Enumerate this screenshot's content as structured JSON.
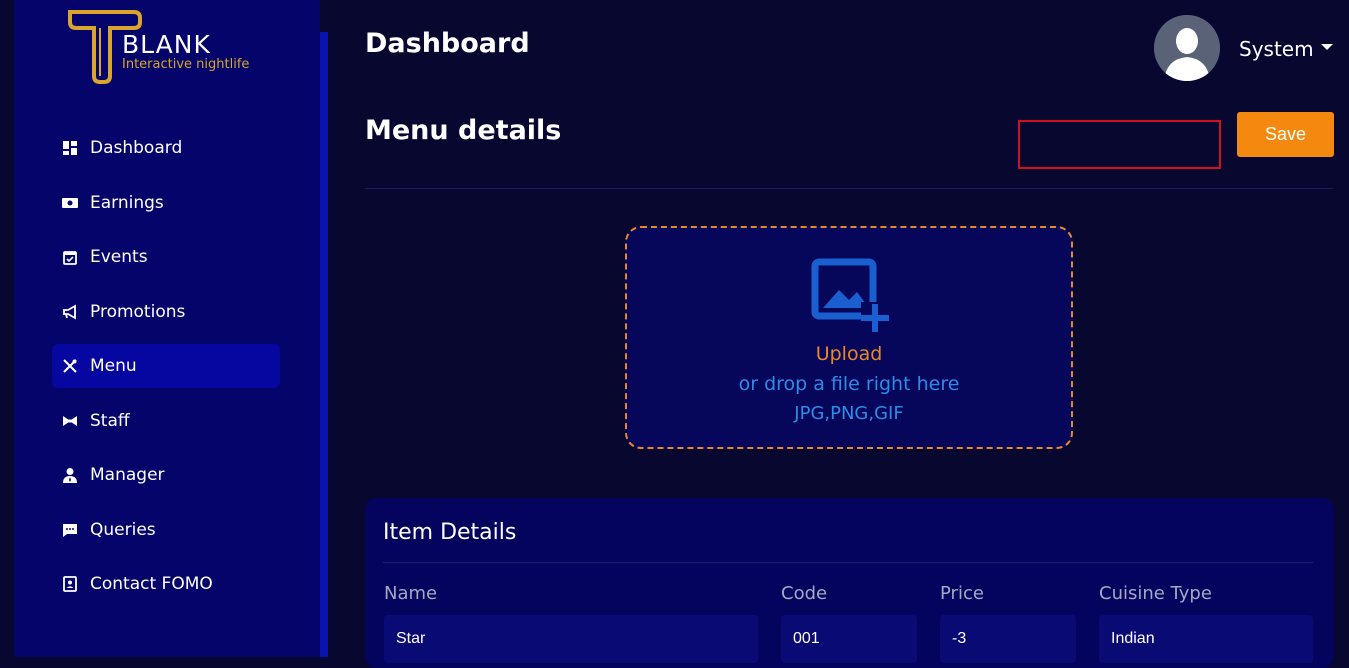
{
  "brand": {
    "title": "BLANK",
    "subtitle": "Interactive nightlife"
  },
  "sidebar": {
    "items": [
      {
        "label": "Dashboard",
        "icon": "dashboard-icon",
        "active": false
      },
      {
        "label": "Earnings",
        "icon": "money-icon",
        "active": false
      },
      {
        "label": "Events",
        "icon": "calendar-icon",
        "active": false
      },
      {
        "label": "Promotions",
        "icon": "megaphone-icon",
        "active": false
      },
      {
        "label": "Menu",
        "icon": "utensils-icon",
        "active": true
      },
      {
        "label": "Staff",
        "icon": "bowtie-icon",
        "active": false
      },
      {
        "label": "Manager",
        "icon": "user-tie-icon",
        "active": false
      },
      {
        "label": "Queries",
        "icon": "chat-icon",
        "active": false
      },
      {
        "label": "Contact FOMO",
        "icon": "contact-icon",
        "active": false
      }
    ]
  },
  "header": {
    "title": "Dashboard",
    "user_name": "System"
  },
  "page": {
    "section_title": "Menu details",
    "save_label": "Save"
  },
  "upload": {
    "upload_label": "Upload",
    "drop_label": "or drop a file right here",
    "formats": "JPG,PNG,GIF"
  },
  "item_details": {
    "title": "Item Details",
    "columns": [
      "Name",
      "Code",
      "Price",
      "Cuisine Type"
    ],
    "values": [
      "Star",
      "001",
      "-3",
      "Indian"
    ]
  },
  "colors": {
    "accent": "#f5890f",
    "sidebar_bg": "#04046b",
    "active_item": "#0606a0",
    "page_bg": "#070730",
    "link_blue": "#2f8be8"
  }
}
